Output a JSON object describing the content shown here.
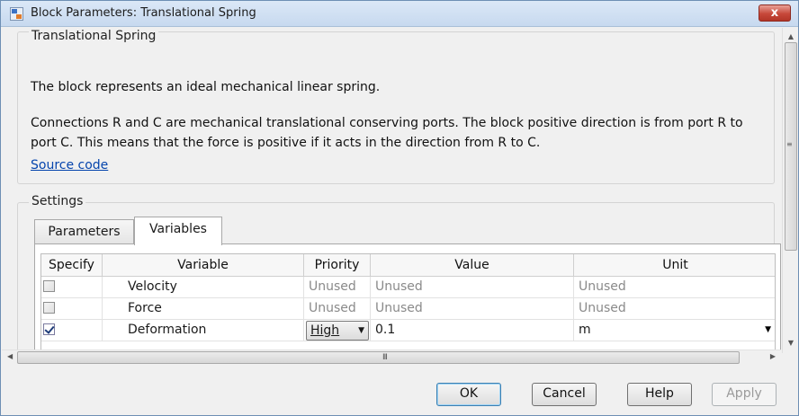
{
  "window": {
    "title": "Block Parameters: Translational Spring",
    "close_label": "x"
  },
  "description": {
    "group_title": "Translational Spring",
    "line1": "The block represents an ideal mechanical linear spring.",
    "line2": "Connections R and C are mechanical translational conserving ports. The block positive direction is from port R to",
    "line3": "port C. This means that the force is positive if it acts in the direction from R to C.",
    "source_link": "Source code"
  },
  "settings": {
    "group_title": "Settings",
    "tabs": [
      {
        "label": "Parameters",
        "active": false
      },
      {
        "label": "Variables",
        "active": true
      }
    ]
  },
  "grid": {
    "headers": [
      "Specify",
      "Variable",
      "Priority",
      "Value",
      "Unit"
    ],
    "rows": [
      {
        "checked": false,
        "variable": "Velocity",
        "priority": "Unused",
        "value": "Unused",
        "unit": "Unused"
      },
      {
        "checked": false,
        "variable": "Force",
        "priority": "Unused",
        "value": "Unused",
        "unit": "Unused"
      },
      {
        "checked": true,
        "variable": "Deformation",
        "priority": "High",
        "value": "0.1",
        "unit": "m"
      }
    ]
  },
  "scrollbar": {
    "grip": "III"
  },
  "buttons": {
    "ok": "OK",
    "cancel": "Cancel",
    "help": "Help",
    "apply": "Apply"
  }
}
